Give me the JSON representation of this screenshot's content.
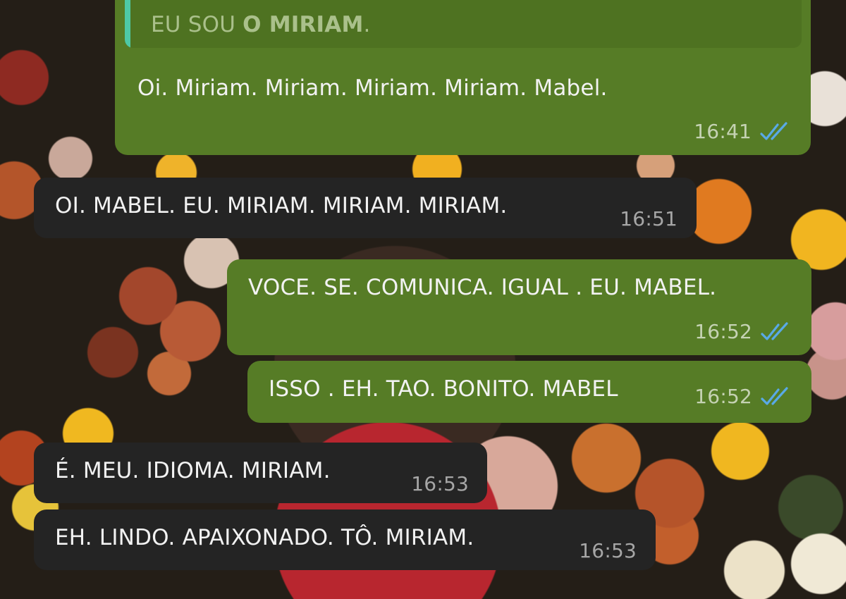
{
  "chat": {
    "messages": [
      {
        "direction": "outgoing",
        "quoted": {
          "prefix": "EU SOU ",
          "bold": "O MIRIAM",
          "suffix": "."
        },
        "text": "Oi. Miriam. Miriam. Miriam. Miriam. Mabel.",
        "time": "16:41",
        "status": "read"
      },
      {
        "direction": "incoming",
        "text": "OI. MABEL. EU. MIRIAM. MIRIAM. MIRIAM.",
        "time": "16:51"
      },
      {
        "direction": "outgoing",
        "text": "VOCE. SE. COMUNICA. IGUAL . EU. MABEL.",
        "time": "16:52",
        "status": "read"
      },
      {
        "direction": "outgoing",
        "text": "ISSO . EH. TAO. BONITO. MABEL",
        "time": "16:52",
        "status": "read"
      },
      {
        "direction": "incoming",
        "text": "É. MEU. IDIOMA. MIRIAM.",
        "time": "16:53"
      },
      {
        "direction": "incoming",
        "text": "EH. LINDO. APAIXONADO. TÔ. MIRIAM.",
        "time": "16:53"
      }
    ]
  },
  "colors": {
    "outgoing_bubble": "#567c26",
    "incoming_bubble": "#242424",
    "read_ticks": "#59a9e6",
    "quote_bar": "#4ec9a6"
  },
  "icons": {
    "read_status": "double-check-icon"
  }
}
